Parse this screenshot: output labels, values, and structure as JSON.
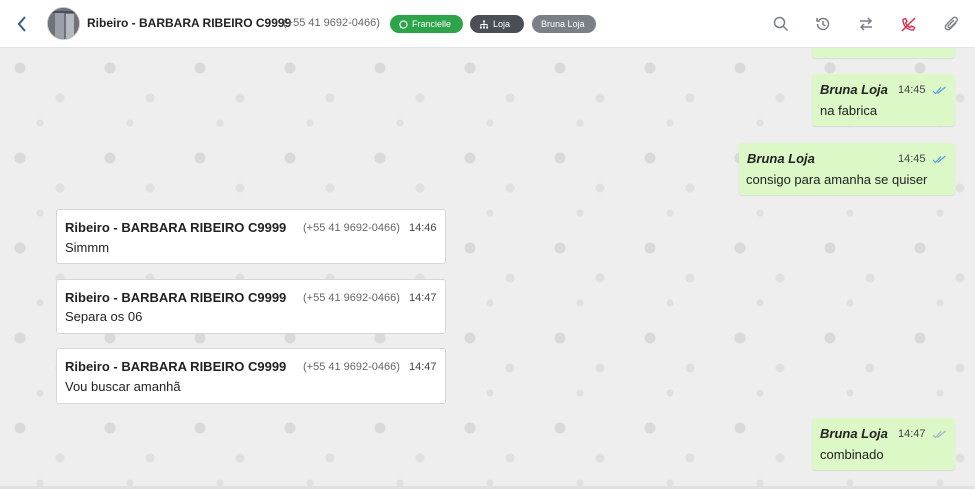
{
  "header": {
    "contact_name": "Ribeiro - BARBARA RIBEIRO C9999",
    "contact_phone": "(+55 41 9692-0466)",
    "tags": [
      {
        "label": "Francielle",
        "color": "#2ea44a",
        "icon": "whatsapp-icon"
      },
      {
        "label": "Loja",
        "color": "#4a4f56",
        "icon": "sitemap-icon"
      },
      {
        "label": "Bruna Loja",
        "color": "#7b8087"
      }
    ],
    "actions": [
      "search-icon",
      "history-icon",
      "transfer-icon",
      "phone-off-icon",
      "paperclip-icon"
    ]
  },
  "messages": [
    {
      "direction": "out",
      "sender": "Bruna Loja",
      "time": "14:45",
      "text": "na fabrica",
      "read": true
    },
    {
      "direction": "out",
      "sender": "Bruna Loja",
      "time": "14:45",
      "text": "consigo para amanha se quiser",
      "read": true
    },
    {
      "direction": "in",
      "sender": "Ribeiro - BARBARA RIBEIRO C9999",
      "phone": "(+55 41 9692-0466)",
      "time": "14:46",
      "text": "Simmm"
    },
    {
      "direction": "in",
      "sender": "Ribeiro - BARBARA RIBEIRO C9999",
      "phone": "(+55 41 9692-0466)",
      "time": "14:47",
      "text": "Separa os 06"
    },
    {
      "direction": "in",
      "sender": "Ribeiro - BARBARA RIBEIRO C9999",
      "phone": "(+55 41 9692-0466)",
      "time": "14:47",
      "text": "Vou buscar amanhã"
    },
    {
      "direction": "out",
      "sender": "Bruna Loja",
      "time": "14:47",
      "text": "combinado",
      "read": true
    }
  ],
  "colors": {
    "outgoing_bubble": "#dcf8c6",
    "incoming_bubble": "#ffffff",
    "read_ticks": "#4fa3e0",
    "accent_green": "#2ea44a",
    "call_icon": "#d9304f"
  }
}
